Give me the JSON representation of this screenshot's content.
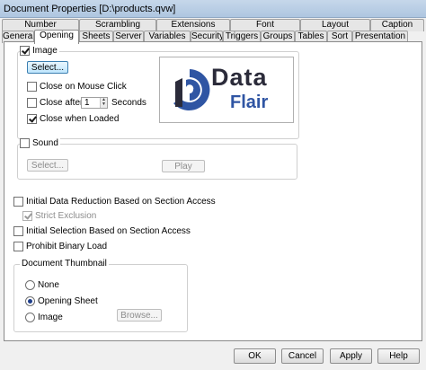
{
  "window": {
    "title": "Document Properties [D:\\products.qvw]"
  },
  "tabs_top": [
    "Number",
    "Scrambling",
    "Extensions",
    "Font",
    "Layout",
    "Caption"
  ],
  "tabs_bottom": [
    "General",
    "Opening",
    "Sheets",
    "Server",
    "Variables",
    "Security",
    "Triggers",
    "Groups",
    "Tables",
    "Sort",
    "Presentation"
  ],
  "active_tab": "Opening",
  "image_group": {
    "label": "Image",
    "checked": true,
    "select_button": "Select...",
    "close_on_click": "Close on Mouse Click",
    "close_after": "Close after",
    "close_after_value": "1",
    "seconds": "Seconds",
    "close_when_loaded": "Close when Loaded",
    "logo": {
      "word1": "Data",
      "word2": "Flair",
      "icon": "data-flair-logo-icon"
    }
  },
  "sound_group": {
    "label": "Sound",
    "select_button": "Select...",
    "play_button": "Play"
  },
  "options": {
    "initial_data_reduction": "Initial Data Reduction Based on Section Access",
    "strict_exclusion": "Strict Exclusion",
    "initial_selection": "Initial Selection Based on Section Access",
    "prohibit_binary_load": "Prohibit Binary Load"
  },
  "thumbnail": {
    "title": "Document Thumbnail",
    "none": "None",
    "opening_sheet": "Opening Sheet",
    "image": "Image",
    "browse_button": "Browse..."
  },
  "footer": {
    "ok": "OK",
    "cancel": "Cancel",
    "apply": "Apply",
    "help": "Help"
  },
  "colors": {
    "logo_blue": "#2f55a3",
    "logo_dark": "#2b2b3a",
    "accent": "#3c7fb1"
  }
}
